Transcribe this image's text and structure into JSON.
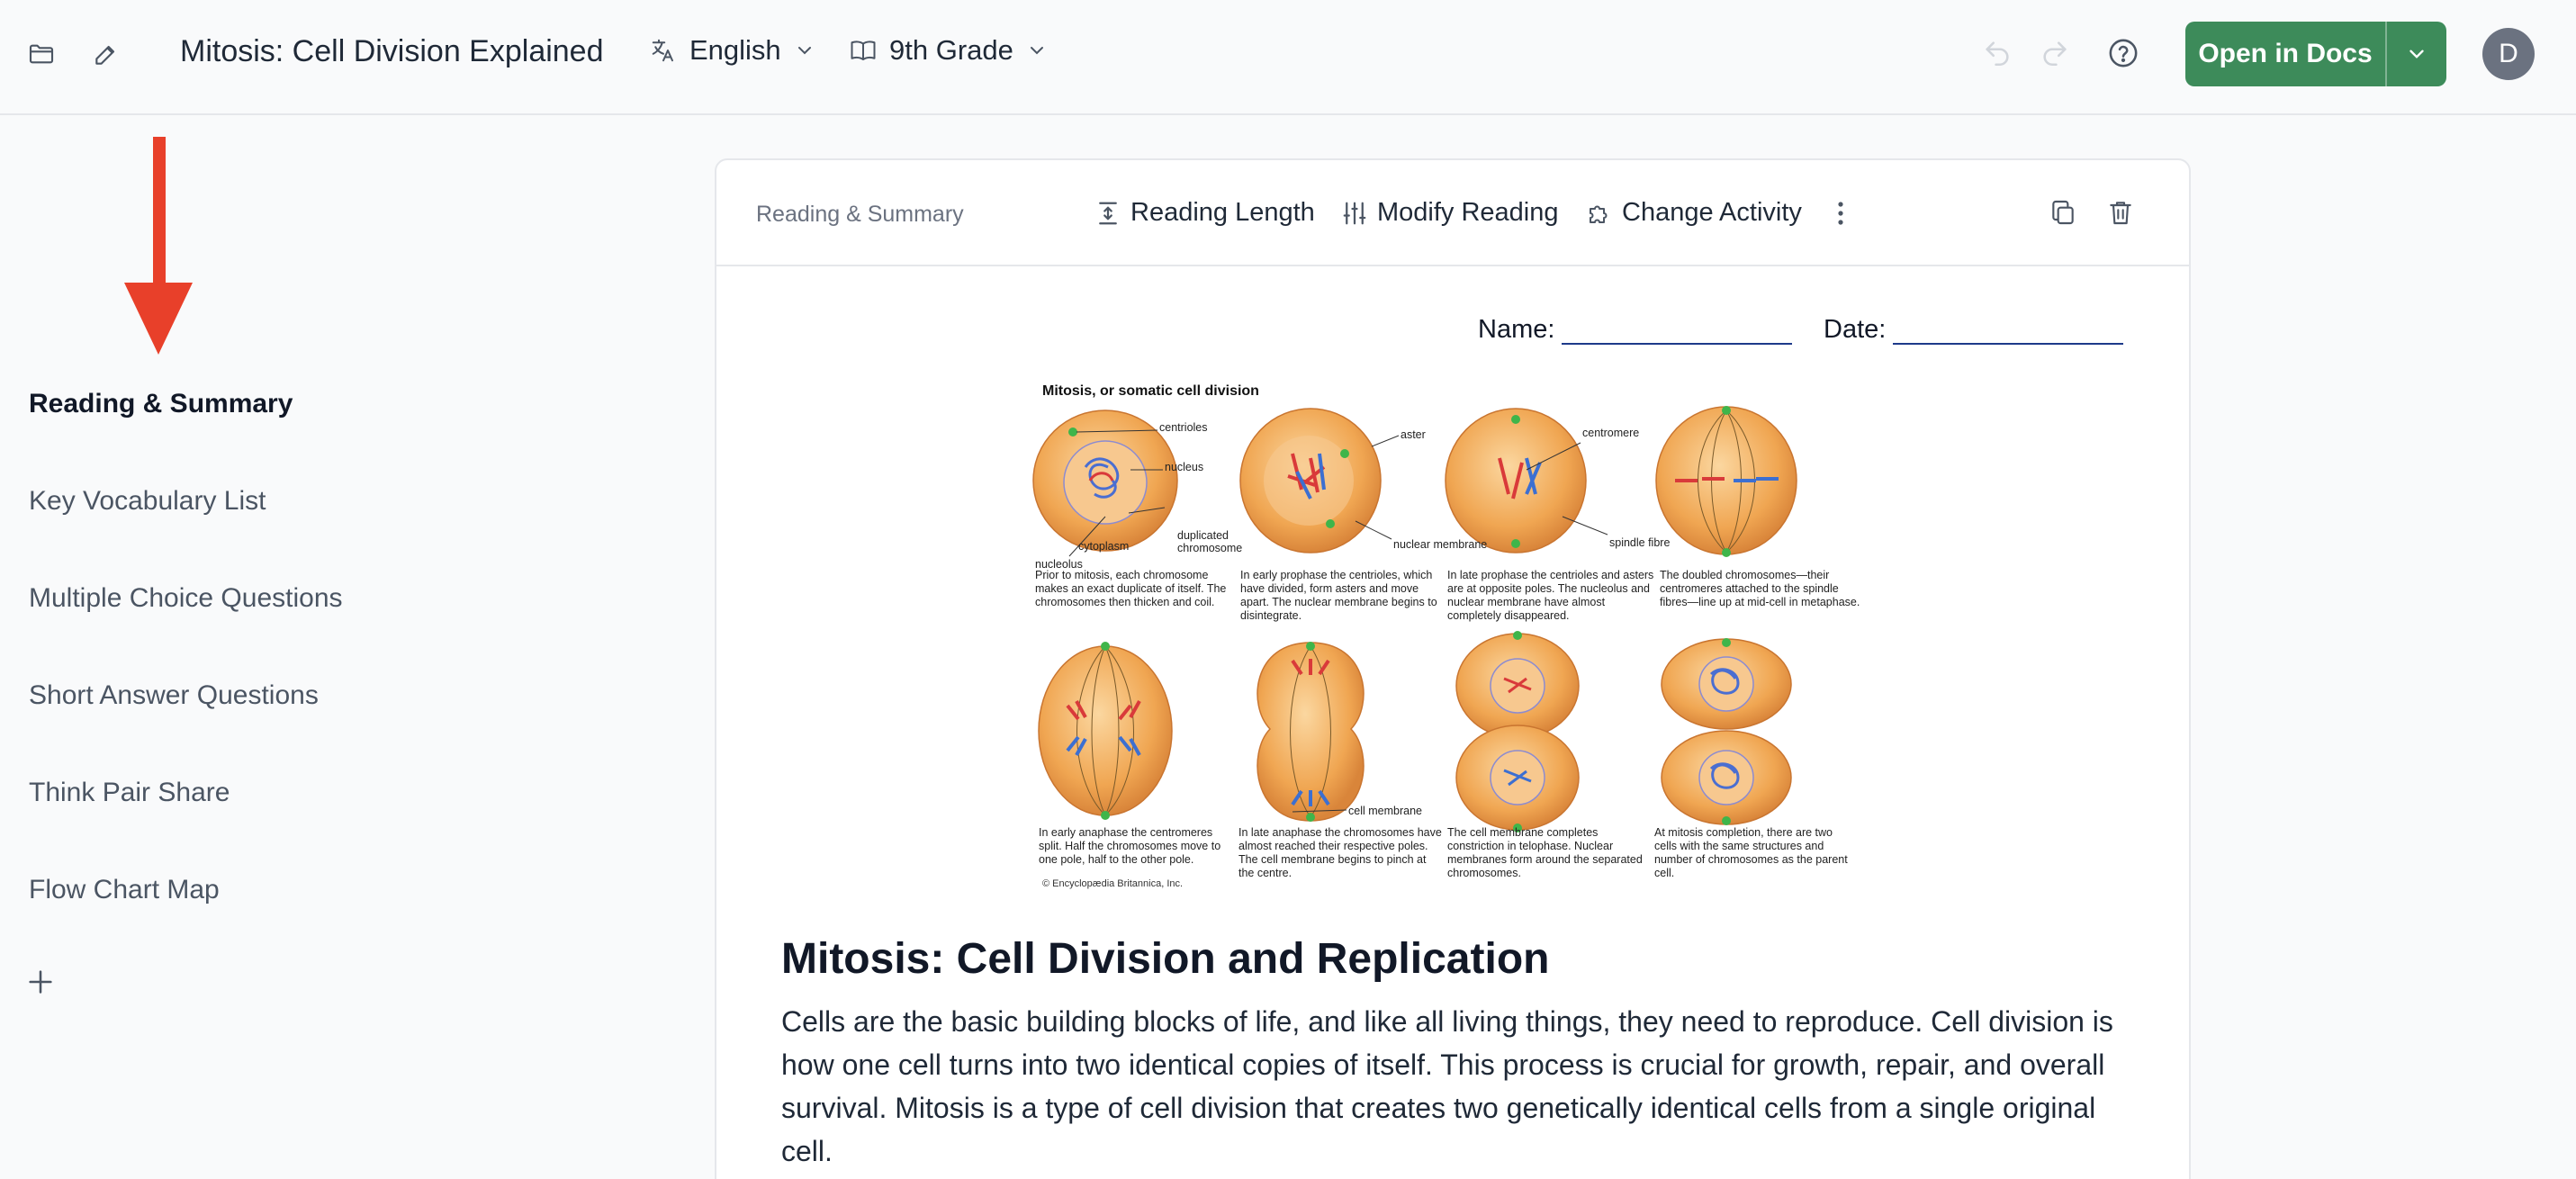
{
  "header": {
    "title": "Mitosis: Cell Division Explained",
    "language": "English",
    "grade": "9th Grade",
    "open_button": "Open in Docs",
    "avatar_initial": "D"
  },
  "sidebar": {
    "items": [
      {
        "label": "Reading & Summary",
        "active": true
      },
      {
        "label": "Key Vocabulary List",
        "active": false
      },
      {
        "label": "Multiple Choice Questions",
        "active": false
      },
      {
        "label": "Short Answer Questions",
        "active": false
      },
      {
        "label": "Think Pair Share",
        "active": false
      },
      {
        "label": "Flow Chart Map",
        "active": false
      }
    ]
  },
  "card": {
    "section_label": "Reading & Summary",
    "reading_length": "Reading Length",
    "modify_reading": "Modify Reading",
    "change_activity": "Change Activity"
  },
  "worksheet": {
    "name_label": "Name:",
    "date_label": "Date:"
  },
  "figure": {
    "title": "Mitosis, or somatic cell division",
    "labels": {
      "centrioles": "centrioles",
      "nucleus": "nucleus",
      "nucleolus": "nucleolus",
      "cytoplasm": "cytoplasm",
      "duplicated_chromosome": "duplicated chromosome",
      "aster": "aster",
      "nuclear_membrane": "nuclear membrane",
      "centromere": "centromere",
      "spindle_fibre": "spindle fibre",
      "cell_membrane": "cell membrane"
    },
    "captions": [
      "Prior to mitosis, each chromosome makes an exact duplicate of itself. The chromosomes then thicken and coil.",
      "In early prophase the centrioles, which have divided, form asters and move apart. The nuclear membrane begins to disintegrate.",
      "In late prophase the centrioles and asters are at opposite poles. The nucleolus and nuclear membrane have almost completely disappeared.",
      "The doubled chromosomes—their centromeres attached to the spindle fibres—line up at mid-cell in metaphase.",
      "In early anaphase the centromeres split. Half the chromosomes move to one pole, half to the other pole.",
      "In late anaphase the chromosomes have almost reached their respective poles. The cell membrane begins to pinch at the centre.",
      "The cell membrane completes constriction in telophase. Nuclear membranes form around the separated chromosomes.",
      "At mitosis completion, there are two cells with the same structures and number of chromosomes as the parent cell."
    ],
    "copyright": "© Encyclopædia Britannica, Inc."
  },
  "article": {
    "title": "Mitosis: Cell Division and Replication",
    "body": "Cells are the basic building blocks of life, and like all living things, they need to reproduce. Cell division is how one cell turns into two identical copies of itself. This process is crucial for growth, repair, and overall survival. Mitosis is a type of cell division that creates two genetically identical cells from a single original cell."
  },
  "colors": {
    "accent_green": "#3d8b5a",
    "annotation_arrow": "#e8402a",
    "cell_fill": "#f0a652",
    "chromosome_red": "#d93a3a",
    "chromosome_blue": "#3c6fd1"
  },
  "icons": [
    "folder-icon",
    "edit-icon",
    "translate-icon",
    "book-icon",
    "chevron-down-icon",
    "undo-icon",
    "redo-icon",
    "help-icon",
    "reading-length-icon",
    "sliders-icon",
    "puzzle-icon",
    "more-vertical-icon",
    "copy-icon",
    "trash-icon",
    "plus-icon"
  ]
}
